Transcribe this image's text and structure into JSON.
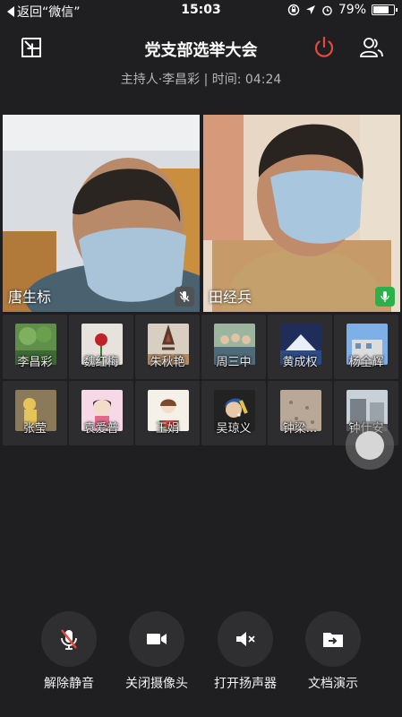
{
  "status_bar": {
    "back_label": "返回“微信”",
    "time": "15:03",
    "battery": "79%",
    "battery_level": 0.79
  },
  "header": {
    "title": "党支部选举大会",
    "subtitle": "主持人·李昌彩 | 时间: 04:24"
  },
  "videos": [
    {
      "name": "唐生标",
      "mic": "muted"
    },
    {
      "name": "田经兵",
      "mic": "active"
    }
  ],
  "participants": [
    {
      "name": "李昌彩",
      "avatar": "green-trees-photo"
    },
    {
      "name": "魏红梅",
      "avatar": "red-rose-photo"
    },
    {
      "name": "朱秋艳",
      "avatar": "gymnast-photo"
    },
    {
      "name": "周三中",
      "avatar": "group-people-photo"
    },
    {
      "name": "黄成权",
      "avatar": "mountain-lake-photo"
    },
    {
      "name": "杨全辉",
      "avatar": "building-sky-photo"
    },
    {
      "name": "张莹",
      "avatar": "yellow-figure-photo"
    },
    {
      "name": "袁爱普",
      "avatar": "cartoon-girl-pink"
    },
    {
      "name": "王娟",
      "avatar": "cartoon-girl-watermelon"
    },
    {
      "name": "吴琼义",
      "avatar": "girl-pearl-earring"
    },
    {
      "name": "钟梁...",
      "avatar": "beige-pattern"
    },
    {
      "name": "钟仕安",
      "avatar": "street-photo"
    }
  ],
  "controls": [
    {
      "label": "解除静音",
      "icon": "mic-muted-icon"
    },
    {
      "label": "关闭摄像头",
      "icon": "camera-icon"
    },
    {
      "label": "打开扬声器",
      "icon": "speaker-off-icon"
    },
    {
      "label": "文档演示",
      "icon": "folder-share-icon"
    }
  ],
  "colors": {
    "end_call": "#e5493a",
    "mic_active": "#2cb04c",
    "background": "#1f1f21"
  }
}
